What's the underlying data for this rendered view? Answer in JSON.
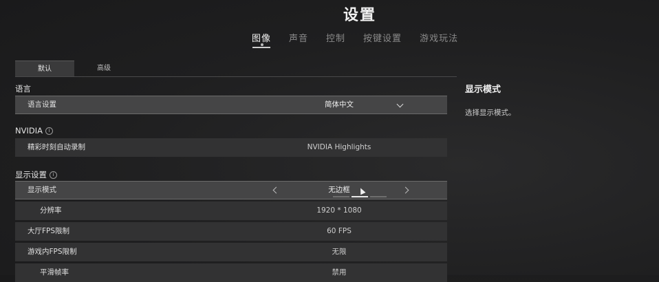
{
  "page_title": "设置",
  "nav_tabs": [
    {
      "label": "图像",
      "active": true
    },
    {
      "label": "声音"
    },
    {
      "label": "控制"
    },
    {
      "label": "按键设置"
    },
    {
      "label": "游戏玩法"
    }
  ],
  "subtabs": [
    {
      "label": "默认",
      "active": true
    },
    {
      "label": "高级"
    }
  ],
  "sections": {
    "language": {
      "title": "语言",
      "rows": [
        {
          "label": "语言设置",
          "value": "简体中文",
          "control": "dropdown"
        }
      ]
    },
    "nvidia": {
      "title": "NVIDIA",
      "info_icon": "i",
      "rows": [
        {
          "label": "精彩时刻自动录制",
          "value": "NVIDIA Highlights"
        }
      ]
    },
    "display": {
      "title": "显示设置",
      "info_icon": "i",
      "rows": [
        {
          "label": "显示模式",
          "value": "无边框",
          "control": "carousel",
          "selected_index": 1,
          "option_count": 3
        },
        {
          "label": "分辨率",
          "value": "1920 * 1080"
        },
        {
          "label": "大厅FPS限制",
          "value": "60 FPS"
        },
        {
          "label": "游戏内FPS限制",
          "value": "无限"
        },
        {
          "label": "平滑帧率",
          "value": "禁用"
        }
      ]
    }
  },
  "description": {
    "title": "显示模式",
    "text": "选择显示模式。"
  },
  "icons": {
    "dropdown": "chevron-down-icon",
    "prev": "chevron-left-icon",
    "next": "chevron-right-icon",
    "info": "info-icon",
    "cursor": "mouse-cursor-icon"
  }
}
